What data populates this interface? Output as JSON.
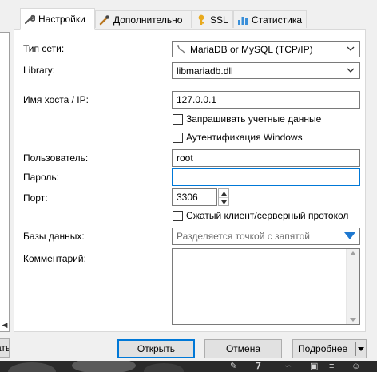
{
  "tabs": [
    {
      "label": "Настройки",
      "icon": "wrench-icon",
      "active": true
    },
    {
      "label": "Дополнительно",
      "icon": "tools-icon",
      "active": false
    },
    {
      "label": "SSL",
      "icon": "key-icon",
      "active": false
    },
    {
      "label": "Статистика",
      "icon": "bar-chart-icon",
      "active": false
    }
  ],
  "form": {
    "network_type": {
      "label": "Тип сети:",
      "value": "MariaDB or MySQL (TCP/IP)"
    },
    "library": {
      "label": "Library:",
      "value": "libmariadb.dll"
    },
    "host": {
      "label": "Имя хоста / IP:",
      "value": "127.0.0.1"
    },
    "prompt_credentials": {
      "label": "Запрашивать учетные данные",
      "checked": false
    },
    "windows_auth": {
      "label": "Аутентификация Windows",
      "checked": false
    },
    "user": {
      "label": "Пользователь:",
      "value": "root"
    },
    "password": {
      "label": "Пароль:",
      "value": ""
    },
    "port": {
      "label": "Порт:",
      "value": "3306"
    },
    "compressed": {
      "label": "Сжатый клиент/серверный протокол",
      "checked": false
    },
    "databases": {
      "label": "Базы данных:",
      "placeholder": "Разделяется точкой с запятой"
    },
    "comment": {
      "label": "Комментарий:",
      "value": ""
    }
  },
  "buttons": {
    "open": "Открыть",
    "cancel": "Отмена",
    "more": "Подробнее",
    "left_partial": "ать"
  },
  "colors": {
    "accent": "#0078d7",
    "dropdown_arrow": "#1e78d0"
  }
}
